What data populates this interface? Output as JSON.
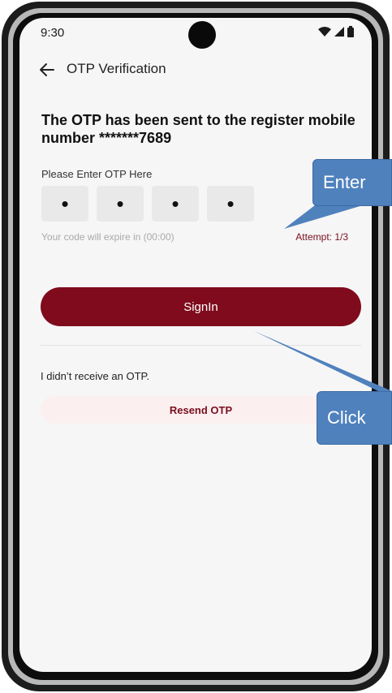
{
  "status_bar": {
    "time": "9:30",
    "icons": [
      "wifi-icon",
      "signal-icon",
      "battery-icon"
    ]
  },
  "app_bar": {
    "back_icon": "arrow-left-icon",
    "title": "OTP Verification"
  },
  "otp_screen": {
    "heading": "The OTP has been sent to the register mobile number *******7689",
    "input_label": "Please Enter OTP Here",
    "otp_digits": [
      "•",
      "•",
      "•",
      "•"
    ],
    "expire_text": "Your code will expire in (00:00)",
    "attempt_text": "Attempt: 1/3",
    "signin_label": "SignIn",
    "no_otp_text": "I didn’t receive an OTP.",
    "resend_label": "Resend OTP"
  },
  "callouts": {
    "enter_text": "Enter",
    "click_text": "Click"
  },
  "colors": {
    "primary": "#7f0b1c",
    "resend_bg": "#fbeff0",
    "callout": "#4f81bd",
    "screen_bg": "#f6f6f6"
  }
}
